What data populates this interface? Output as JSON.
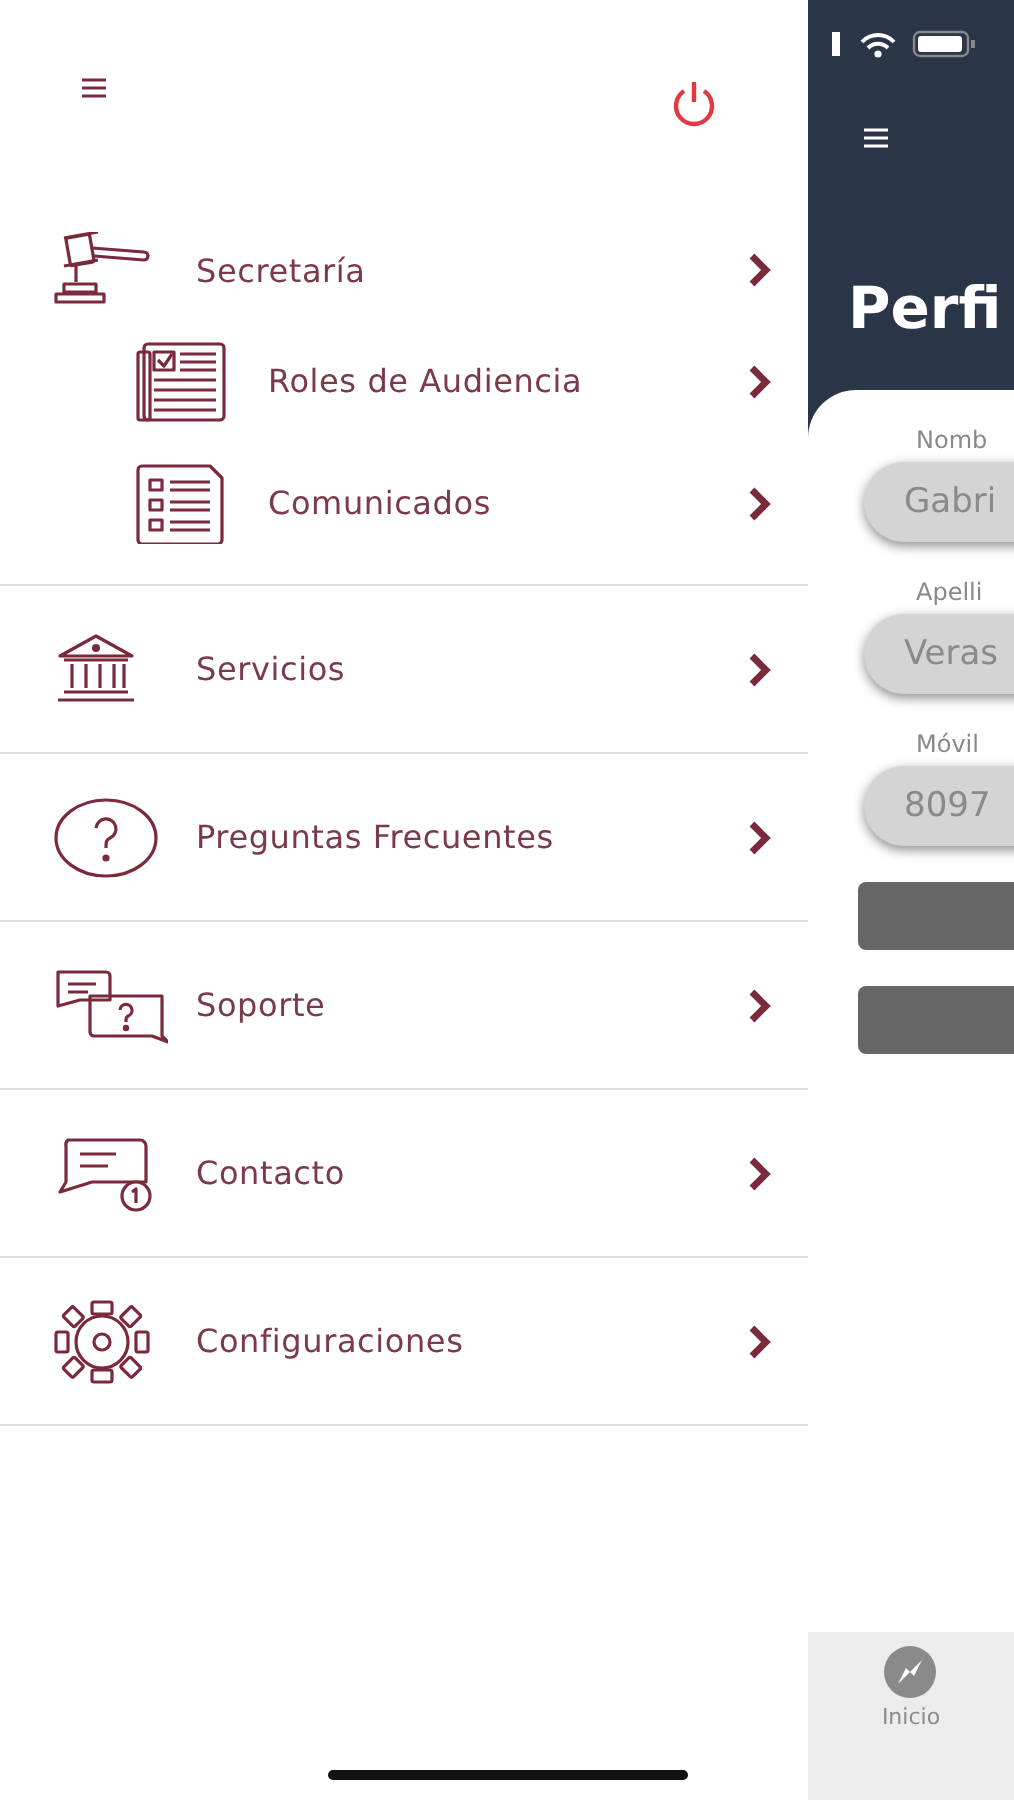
{
  "drawer": {
    "items": [
      {
        "label": "Secretaría",
        "children": [
          {
            "label": "Roles de Audiencia"
          },
          {
            "label": "Comunicados"
          }
        ]
      },
      {
        "label": "Servicios"
      },
      {
        "label": "Preguntas Frecuentes"
      },
      {
        "label": "Soporte"
      },
      {
        "label": "Contacto"
      },
      {
        "label": "Configuraciones"
      }
    ]
  },
  "profile": {
    "title": "Perfi",
    "fields": [
      {
        "label": "Nomb",
        "value": "Gabri"
      },
      {
        "label": "Apelli",
        "value": "Veras"
      },
      {
        "label": "Móvil",
        "value": "8097"
      }
    ],
    "tab_bar": {
      "tabs": [
        {
          "label": "Inicio",
          "selected": false
        }
      ]
    }
  }
}
